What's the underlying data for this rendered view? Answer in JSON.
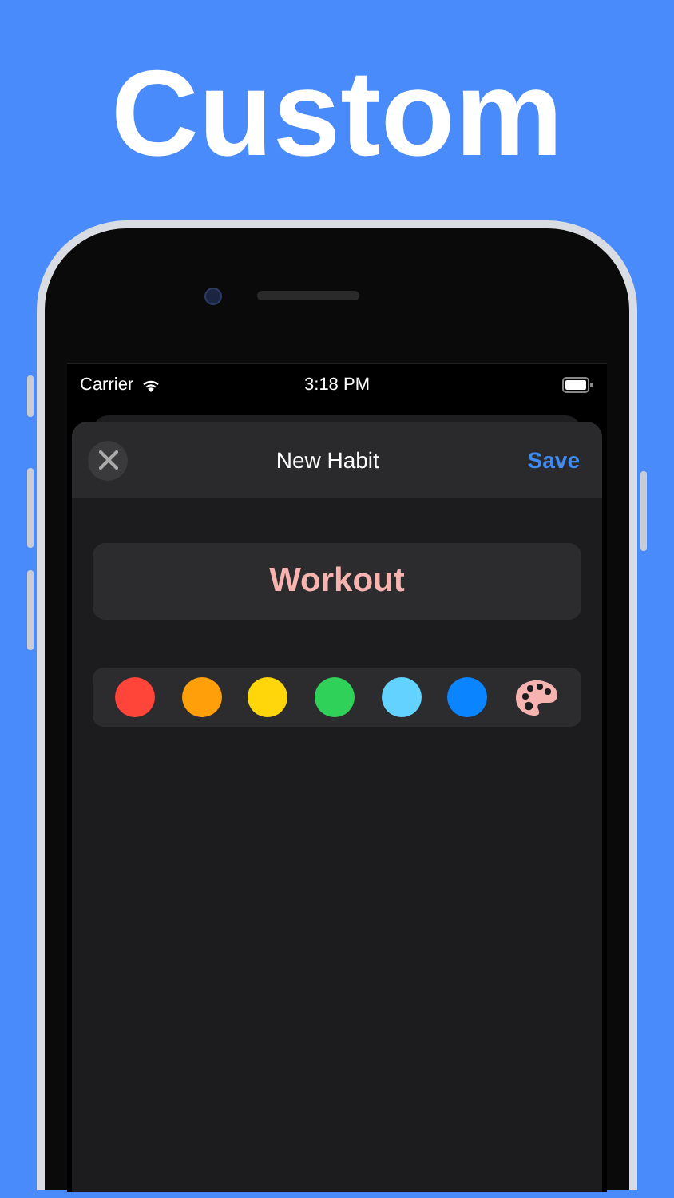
{
  "headline": "Custom",
  "status_bar": {
    "carrier": "Carrier",
    "time": "3:18 PM"
  },
  "header": {
    "title": "New Habit",
    "action": "Save"
  },
  "name_field": {
    "value": "Workout",
    "color": "#f6b3b0"
  },
  "colors": [
    {
      "kind": "swatch",
      "color": "#ff453a"
    },
    {
      "kind": "swatch",
      "color": "#ff9f0a"
    },
    {
      "kind": "swatch",
      "color": "#ffd60a"
    },
    {
      "kind": "swatch",
      "color": "#30d158"
    },
    {
      "kind": "swatch",
      "color": "#64d2ff"
    },
    {
      "kind": "swatch",
      "color": "#0a84ff"
    },
    {
      "kind": "palette",
      "color": "#f6b3b0"
    }
  ]
}
